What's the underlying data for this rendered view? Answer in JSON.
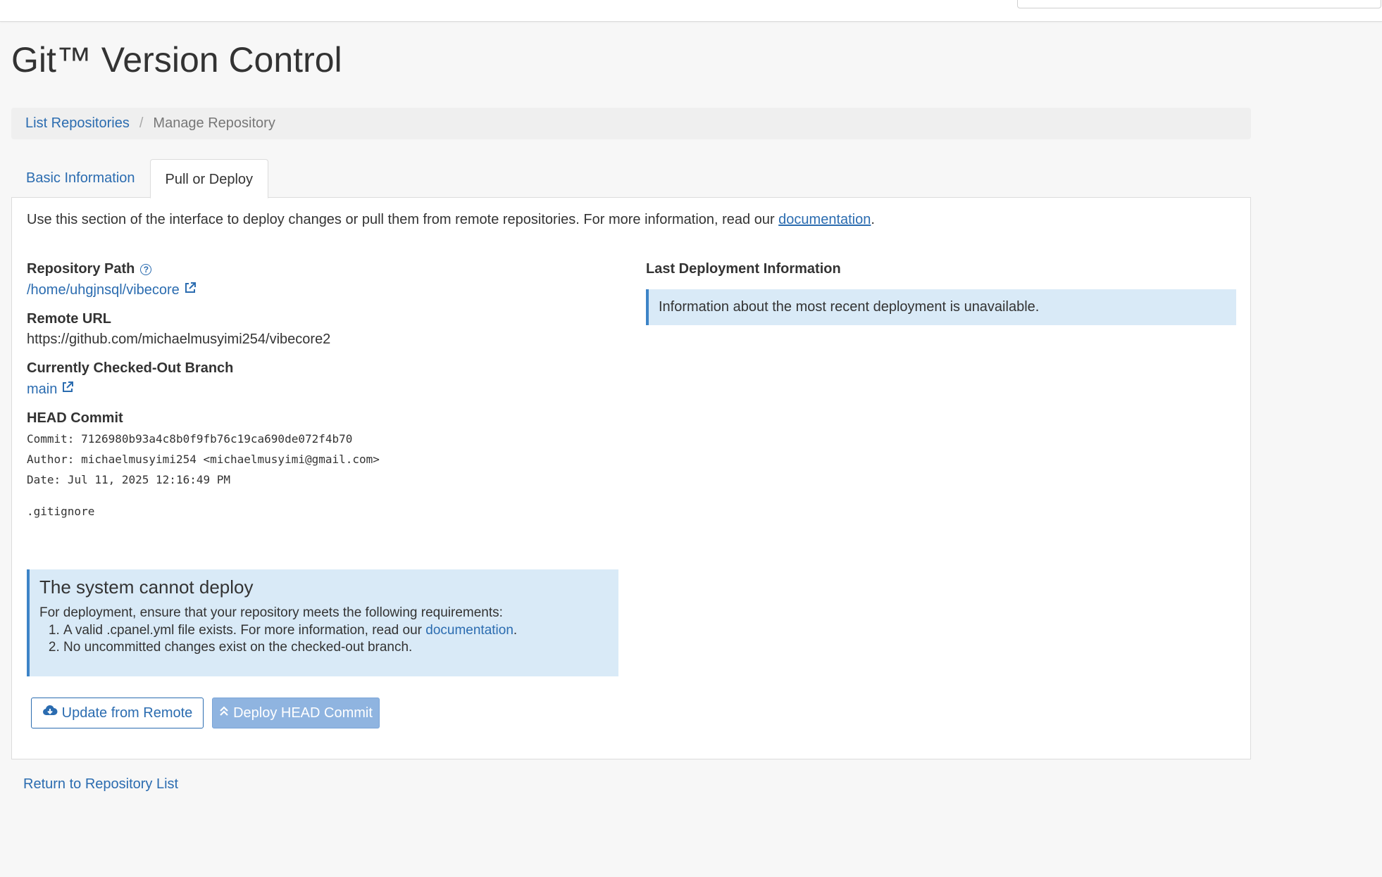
{
  "header": {
    "title": "Git™ Version Control"
  },
  "breadcrumb": {
    "link": "List Repositories",
    "separator": "/",
    "current": "Manage Repository"
  },
  "tabs": [
    {
      "label": "Basic Information"
    },
    {
      "label": "Pull or Deploy"
    }
  ],
  "intro": {
    "text": "Use this section of the interface to deploy changes or pull them from remote repositories. For more information, read our ",
    "link": "documentation",
    "suffix": "."
  },
  "repository": {
    "path_label": "Repository Path",
    "path_value": "/home/uhgjnsql/vibecore",
    "remote_label": "Remote URL",
    "remote_value": "https://github.com/michaelmusyimi254/vibecore2",
    "branch_label": "Currently Checked-Out Branch",
    "branch_value": "main",
    "head_label": "HEAD Commit",
    "commit_key": "Commit:",
    "commit_value": "7126980b93a4c8b0f9fb76c19ca690de072f4b70",
    "author_key": "Author:",
    "author_value": "michaelmusyimi254 <michaelmusyimi@gmail.com>",
    "date_key": "Date:",
    "date_value": "Jul 11, 2025 12:16:49 PM",
    "message": ".gitignore"
  },
  "deployment": {
    "label": "Last Deployment Information",
    "info": "Information about the most recent deployment is unavailable."
  },
  "alert": {
    "title": "The system cannot deploy",
    "intro": "For deployment, ensure that your repository meets the following requirements:",
    "item1_text": "A valid .cpanel.yml file exists. For more information, read our ",
    "item1_link": "documentation",
    "item1_suffix": ".",
    "item2_text": "No uncommitted changes exist on the checked-out branch."
  },
  "buttons": {
    "update": "Update from Remote",
    "deploy": "Deploy HEAD Commit"
  },
  "footer": {
    "return_link": "Return to Repository List"
  },
  "colors": {
    "link": "#2b6cb0",
    "info_bg": "#d9eaf7",
    "info_border": "#3d84c7",
    "deploy_disabled": "#8fb4e0"
  }
}
